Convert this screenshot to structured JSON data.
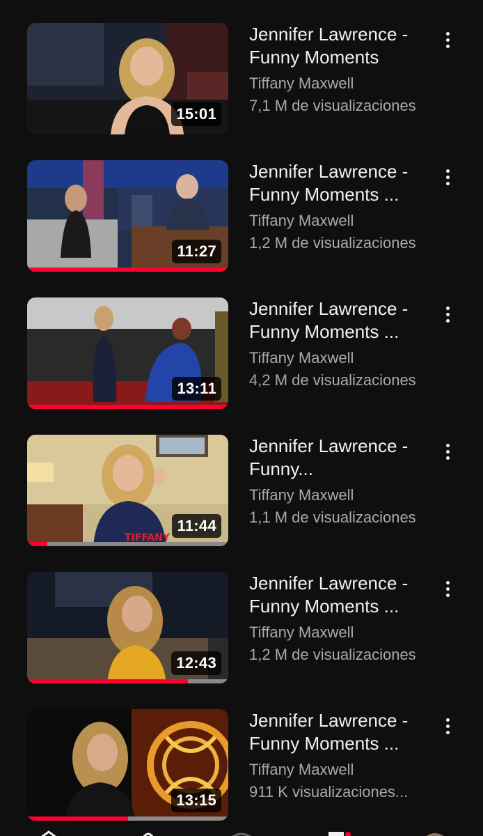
{
  "videos": [
    {
      "title": "Jennifer Lawrence - Funny Moments",
      "channel": "Tiffany Maxwell",
      "views": "7,1 M de visualizaciones",
      "duration": "15:01",
      "watched_fraction": 0.0
    },
    {
      "title": "Jennifer Lawrence - Funny Moments ...",
      "channel": "Tiffany Maxwell",
      "views": "1,2 M de visualizaciones",
      "duration": "11:27",
      "watched_fraction": 1.0
    },
    {
      "title": "Jennifer Lawrence - Funny Moments ...",
      "channel": "Tiffany Maxwell",
      "views": "4,2 M de visualizaciones",
      "duration": "13:11",
      "watched_fraction": 1.0
    },
    {
      "title": "Jennifer Lawrence - Funny...",
      "channel": "Tiffany Maxwell",
      "views": "1,1 M de visualizaciones",
      "duration": "11:44",
      "watched_fraction": 0.1
    },
    {
      "title": "Jennifer Lawrence - Funny Moments ...",
      "channel": "Tiffany Maxwell",
      "views": "1,2 M de visualizaciones",
      "duration": "12:43",
      "watched_fraction": 0.8
    },
    {
      "title": "Jennifer Lawrence - Funny Moments ...",
      "channel": "Tiffany Maxwell",
      "views": "911 K visualizaciones...",
      "duration": "13:15",
      "watched_fraction": 0.5
    }
  ],
  "colors": {
    "background": "#0f0f0f",
    "progress": "#ff0033",
    "secondary_text": "#aaaaaa"
  }
}
